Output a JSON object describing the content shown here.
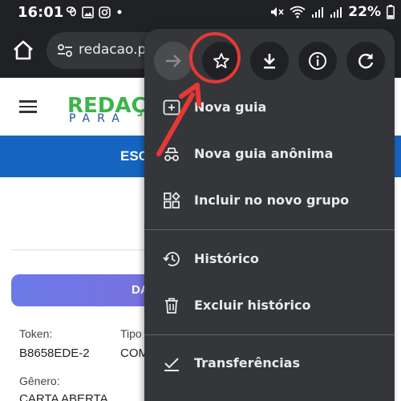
{
  "status_bar": {
    "time": "16:01",
    "battery": "22%",
    "left_icons": [
      "pinwheel-icon",
      "image-icon",
      "instagram-icon",
      "dot-icon"
    ],
    "right_icons": [
      "mute-icon",
      "wifi-icon",
      "signal-icon",
      "signal-icon",
      "battery-icon"
    ]
  },
  "browser": {
    "url_text": "redacao.pr",
    "icons": [
      "home-icon",
      "site-settings-icon"
    ]
  },
  "page": {
    "logo_top": "REDAÇ",
    "logo_sub": "PARA",
    "banner_text": "ESC",
    "button_text": "DA",
    "token_label": "Token:",
    "token_value": "B8658EDE-2",
    "tipo_label": "Tipo",
    "tipo_value": "COM",
    "genero_label": "Gênero:",
    "genero_value": "CARTA ABERTA"
  },
  "menu": {
    "actions": [
      "forward-icon",
      "bookmark-star-icon",
      "download-icon",
      "info-icon",
      "refresh-icon"
    ],
    "items": [
      {
        "label": "Nova guia",
        "icon": "new-tab-icon"
      },
      {
        "label": "Nova guia anônima",
        "icon": "incognito-icon"
      },
      {
        "label": "Incluir no novo grupo",
        "icon": "tab-group-icon"
      },
      {
        "label": "Histórico",
        "icon": "history-icon"
      },
      {
        "label": "Excluir histórico",
        "icon": "trash-icon"
      },
      {
        "label": "Transferências",
        "icon": "downloads-check-icon"
      }
    ]
  },
  "colors": {
    "annotation": "#e53935",
    "menu_bg": "#35363a",
    "toolbar_bg": "#202124",
    "banner": "#1565c0"
  }
}
